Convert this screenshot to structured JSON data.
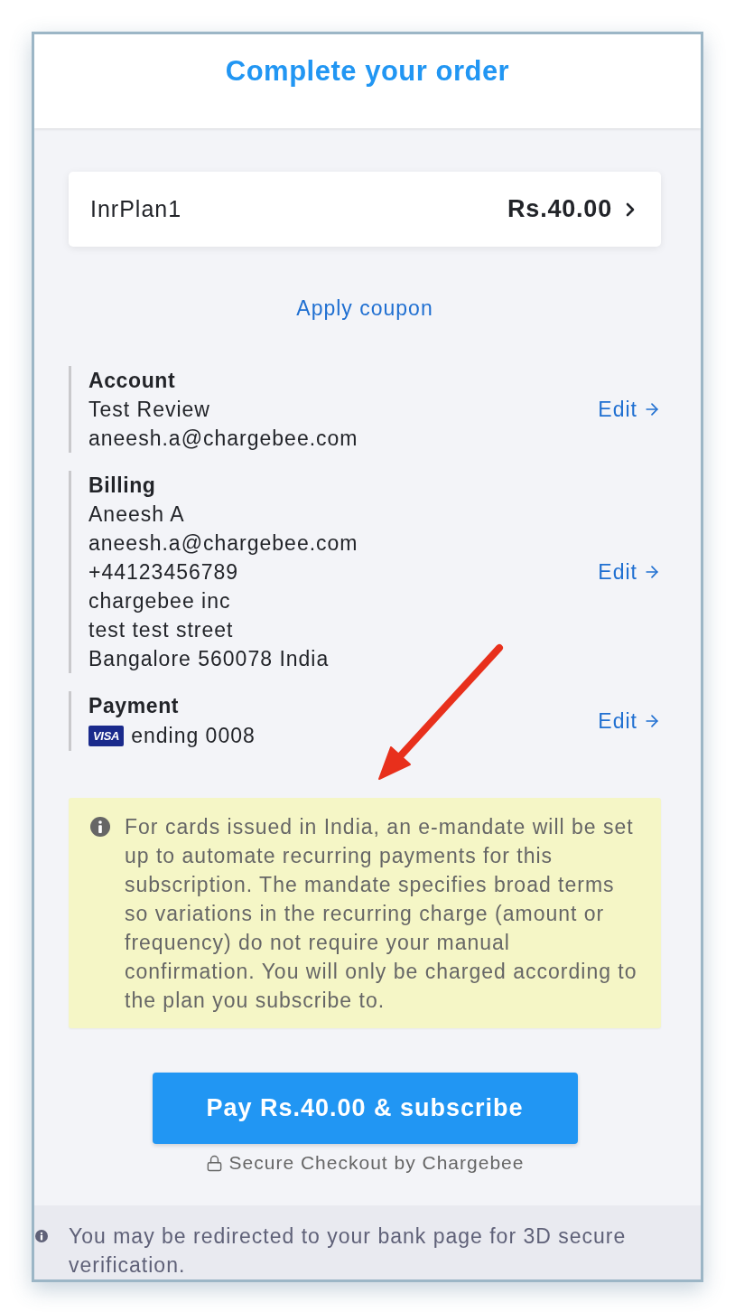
{
  "header": {
    "title": "Complete your order"
  },
  "plan": {
    "name": "InrPlan1",
    "price": "Rs.40.00"
  },
  "coupon_link": "Apply coupon",
  "sections": [
    {
      "kind": "details",
      "heading": "Account",
      "lines": [
        "Test Review",
        "aneesh.a@chargebee.com"
      ],
      "edit": "Edit"
    },
    {
      "kind": "details",
      "heading": "Billing",
      "lines": [
        "Aneesh A",
        "aneesh.a@chargebee.com",
        "+44123456789",
        "chargebee inc",
        "test test street",
        "Bangalore 560078 India"
      ],
      "edit": "Edit"
    },
    {
      "kind": "card",
      "heading": "Payment",
      "card_brand": "VISA",
      "card_text": "ending 0008",
      "edit": "Edit"
    }
  ],
  "notice": "For cards issued in India, an e-mandate will be set up to automate recurring payments for this subscription. The mandate specifies broad terms so variations in the recurring charge (amount or frequency) do not require your manual confirmation. You will only be charged according to the plan you subscribe to.",
  "pay_button": "Pay Rs.40.00 & subscribe",
  "secure_note": "Secure Checkout by Chargebee",
  "footer_note": "You may be redirected to your bank page for 3D secure verification."
}
